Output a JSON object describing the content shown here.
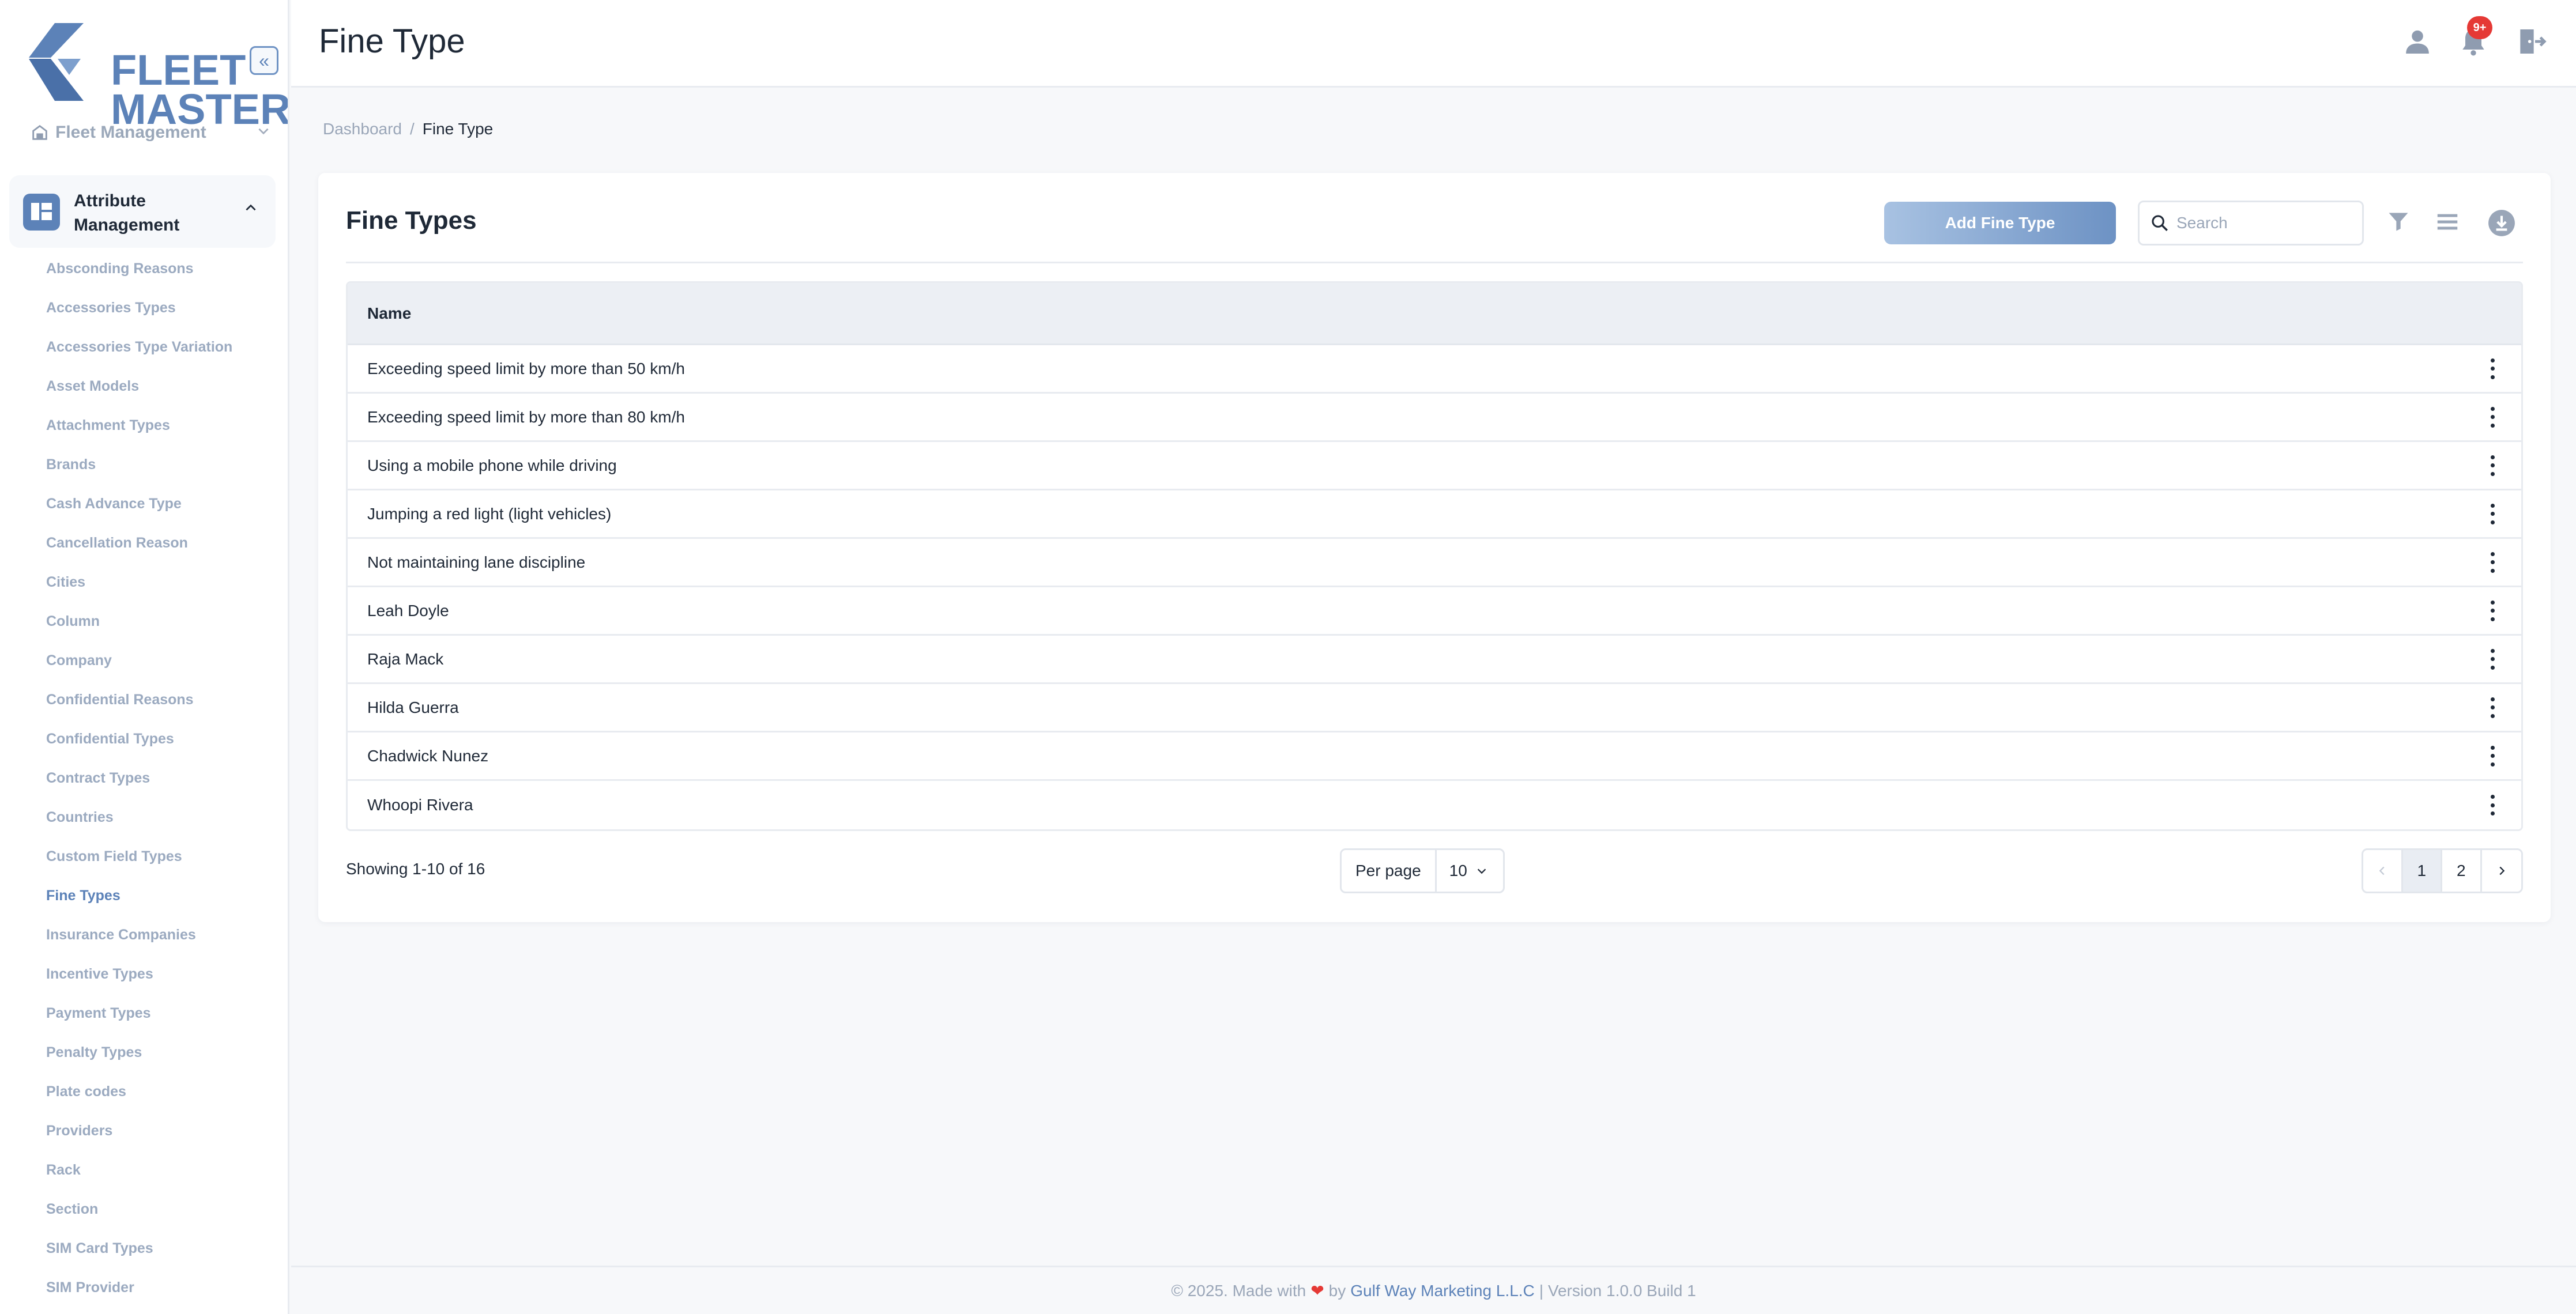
{
  "brand": {
    "line1": "FLEET",
    "line2": "MASTER",
    "accent": "#5c82b8"
  },
  "sidebar": {
    "fleet_label": "Fleet Management",
    "attr_label_1": "Attribute",
    "attr_label_2": "Management",
    "items": [
      {
        "label": "Absconding Reasons"
      },
      {
        "label": "Accessories Types"
      },
      {
        "label": "Accessories Type Variation"
      },
      {
        "label": "Asset Models"
      },
      {
        "label": "Attachment Types"
      },
      {
        "label": "Brands"
      },
      {
        "label": "Cash Advance Type"
      },
      {
        "label": "Cancellation Reason"
      },
      {
        "label": "Cities"
      },
      {
        "label": "Column"
      },
      {
        "label": "Company"
      },
      {
        "label": "Confidential Reasons"
      },
      {
        "label": "Confidential Types"
      },
      {
        "label": "Contract Types"
      },
      {
        "label": "Countries"
      },
      {
        "label": "Custom Field Types"
      },
      {
        "label": "Fine Types",
        "active": true
      },
      {
        "label": "Insurance Companies"
      },
      {
        "label": "Incentive Types"
      },
      {
        "label": "Payment Types"
      },
      {
        "label": "Penalty Types"
      },
      {
        "label": "Plate codes"
      },
      {
        "label": "Providers"
      },
      {
        "label": "Rack"
      },
      {
        "label": "Section"
      },
      {
        "label": "SIM Card Types"
      },
      {
        "label": "SIM Provider"
      }
    ]
  },
  "header": {
    "title": "Fine Type",
    "notification_badge": "9+",
    "icons": [
      "user-icon",
      "bell-icon",
      "logout-icon"
    ]
  },
  "breadcrumb": {
    "root": "Dashboard",
    "separator": "/",
    "current": "Fine Type"
  },
  "card": {
    "title": "Fine Types",
    "add_button": "Add Fine Type",
    "search_placeholder": "Search",
    "search_value": "",
    "table": {
      "column_name": "Name",
      "rows": [
        "Exceeding speed limit by more than 50 km/h",
        "Exceeding speed limit by more than 80 km/h",
        "Using a mobile phone while driving",
        "Jumping a red light (light vehicles)",
        "Not maintaining lane discipline",
        "Leah Doyle",
        "Raja Mack",
        "Hilda Guerra",
        "Chadwick Nunez",
        "Whoopi Rivera"
      ]
    },
    "showing": "Showing 1-10 of 16",
    "per_page_label": "Per page",
    "per_page_value": "10",
    "pages": [
      "1",
      "2"
    ],
    "current_page": "1"
  },
  "footer": {
    "prefix": "© 2025. Made with",
    "by": "by",
    "company": "Gulf Way Marketing L.L.C",
    "suffix": "| Version 1.0.0 Build 1"
  }
}
